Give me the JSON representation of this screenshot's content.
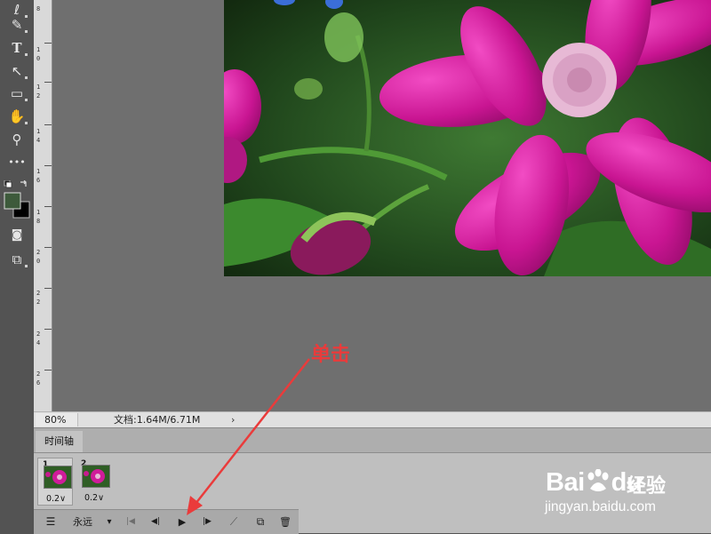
{
  "toolbar": {
    "tools": [
      {
        "name": "lasso-icon",
        "glyph": "ℓ"
      },
      {
        "name": "pen-icon",
        "glyph": "✎"
      },
      {
        "name": "type-icon",
        "glyph": "T"
      },
      {
        "name": "path-select-icon",
        "glyph": "↖"
      },
      {
        "name": "rectangle-icon",
        "glyph": "▭"
      },
      {
        "name": "hand-icon",
        "glyph": "✋"
      },
      {
        "name": "zoom-icon",
        "glyph": "⚲"
      },
      {
        "name": "more-tools-icon",
        "glyph": "•••"
      },
      {
        "name": "quick-mask-icon",
        "glyph": "◙"
      },
      {
        "name": "screen-mode-icon",
        "glyph": "⧉"
      }
    ],
    "foreground_color": "#3d5a3b",
    "background_color": "#000000"
  },
  "ruler": {
    "labels": [
      "8",
      "1",
      "0",
      "1",
      "2",
      "1",
      "4",
      "1",
      "6",
      "1",
      "8",
      "2",
      "0",
      "2",
      "2",
      "2",
      "4",
      "2",
      "6"
    ]
  },
  "status": {
    "zoom": "80%",
    "doc_info": "文档:1.64M/6.71M",
    "arrow": "›"
  },
  "timeline": {
    "tab_label": "时间轴",
    "frames": [
      {
        "number": "1",
        "delay": "0.2∨",
        "selected": true
      },
      {
        "number": "2",
        "delay": "0.2∨",
        "selected": false
      }
    ],
    "loop_label": "永远",
    "loop_caret": "▾",
    "controls": {
      "convert_glyph": "☰",
      "first_glyph": "|◀",
      "prev_glyph": "◀|",
      "play_glyph": "▶",
      "next_glyph": "|▶",
      "tween_glyph": "⟋",
      "duplicate_glyph": "⧉",
      "delete_glyph": "🗑"
    }
  },
  "annotation": {
    "text": "单击",
    "color": "#ea3b3b"
  },
  "watermark": {
    "logo": "Bai🐾 ",
    "logo_text": "Bai",
    "logo_paw": "du",
    "cn": "经验",
    "url": "jingyan.baidu.com"
  }
}
